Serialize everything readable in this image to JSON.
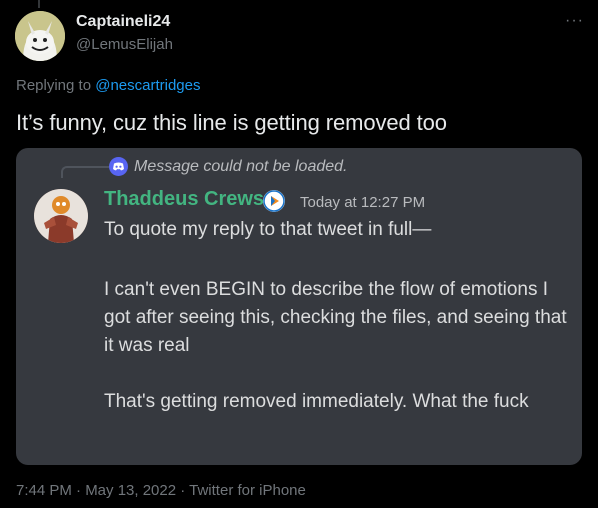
{
  "tweet": {
    "author_name": "Captaineli24",
    "author_handle": "@LemusElijah",
    "more_glyph": "···",
    "replying_prefix": "Replying to ",
    "replying_to": "@nescartridges",
    "text": "It’s funny, cuz this line is getting removed too",
    "footer": "7:44 PM · May 13, 2022 · Twitter for iPhone"
  },
  "embed": {
    "reference_text": "Message could not be loaded.",
    "author_name": "Thaddeus Crews",
    "timestamp": "Today at 12:27 PM",
    "lines": [
      "To quote my reply to that tweet in full—",
      "I can't even BEGIN to describe the flow of emotions I got after seeing this, checking the files, and seeing that it was real",
      "That's getting removed immediately. What the fuck"
    ]
  },
  "colors": {
    "background": "#000000",
    "link": "#1d9bf0",
    "muted": "#71767b",
    "card": "#36393f",
    "discord_name": "#43b581",
    "discord_blurple": "#5865f2"
  }
}
